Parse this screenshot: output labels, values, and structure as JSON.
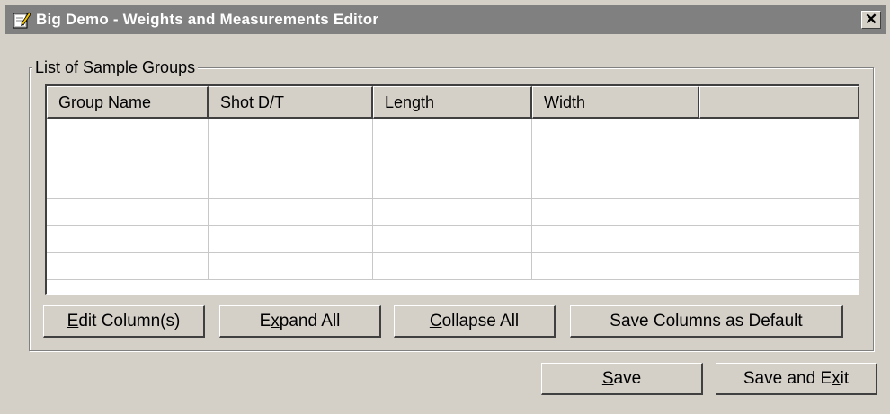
{
  "window": {
    "title": "Big Demo - Weights and Measurements Editor",
    "close_glyph": "✕"
  },
  "group": {
    "label": "List of Sample Groups"
  },
  "table": {
    "columns": [
      "Group Name",
      "Shot D/T",
      "Length",
      "Width",
      ""
    ],
    "rows": [
      [
        "",
        "",
        "",
        "",
        ""
      ],
      [
        "",
        "",
        "",
        "",
        ""
      ],
      [
        "",
        "",
        "",
        "",
        ""
      ],
      [
        "",
        "",
        "",
        "",
        ""
      ],
      [
        "",
        "",
        "",
        "",
        ""
      ],
      [
        "",
        "",
        "",
        "",
        ""
      ]
    ]
  },
  "buttons": {
    "edit_columns": {
      "pre": "",
      "mnemonic": "E",
      "post": "dit Column(s)"
    },
    "expand_all": {
      "pre": "E",
      "mnemonic": "x",
      "post": "pand All"
    },
    "collapse_all": {
      "pre": "",
      "mnemonic": "C",
      "post": "ollapse All"
    },
    "save_columns_default": {
      "pre": "Save Columns as Default",
      "mnemonic": "",
      "post": ""
    },
    "save": {
      "pre": "",
      "mnemonic": "S",
      "post": "ave"
    },
    "save_and_exit": {
      "pre": "Save and E",
      "mnemonic": "x",
      "post": "it"
    }
  }
}
